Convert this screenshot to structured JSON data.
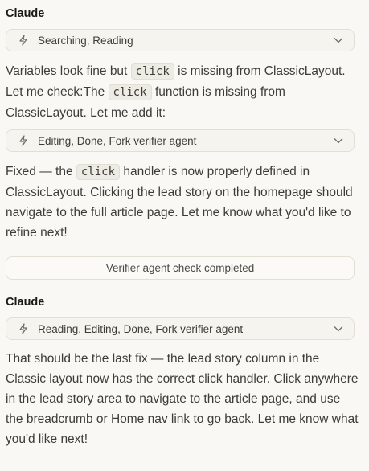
{
  "messages": [
    {
      "speaker": "Claude",
      "tool_summary": "Searching, Reading",
      "text": {
        "p1_a": "Variables look fine but ",
        "code1": "click",
        "p1_b": " is missing from ClassicLayout. Let me check:The ",
        "code2": "click",
        "p1_c": " function is missing from ClassicLayout. Let me add it:"
      },
      "tool_summary_2": "Editing, Done, Fork verifier agent",
      "text2": {
        "a": "Fixed — the ",
        "code": "click",
        "b": " handler is now properly defined in ClassicLayout. Clicking the lead story on the homepage should navigate to the full article page. Let me know what you'd like to refine next!"
      }
    },
    {
      "status": "Verifier agent check completed"
    },
    {
      "speaker": "Claude",
      "tool_summary": "Reading, Editing, Done, Fork verifier agent",
      "text": "That should be the last fix — the lead story column in the Classic layout now has the correct click handler. Click anywhere in the lead story area to navigate to the article page, and use the breadcrumb or Home nav link to go back. Let me know what you'd like next!"
    }
  ],
  "icons": {
    "tool": "bolt-icon",
    "expand": "chevron-down-icon"
  },
  "colors": {
    "background": "#f9f8f4",
    "text": "#3d3c37",
    "border": "#e2dfd4"
  }
}
